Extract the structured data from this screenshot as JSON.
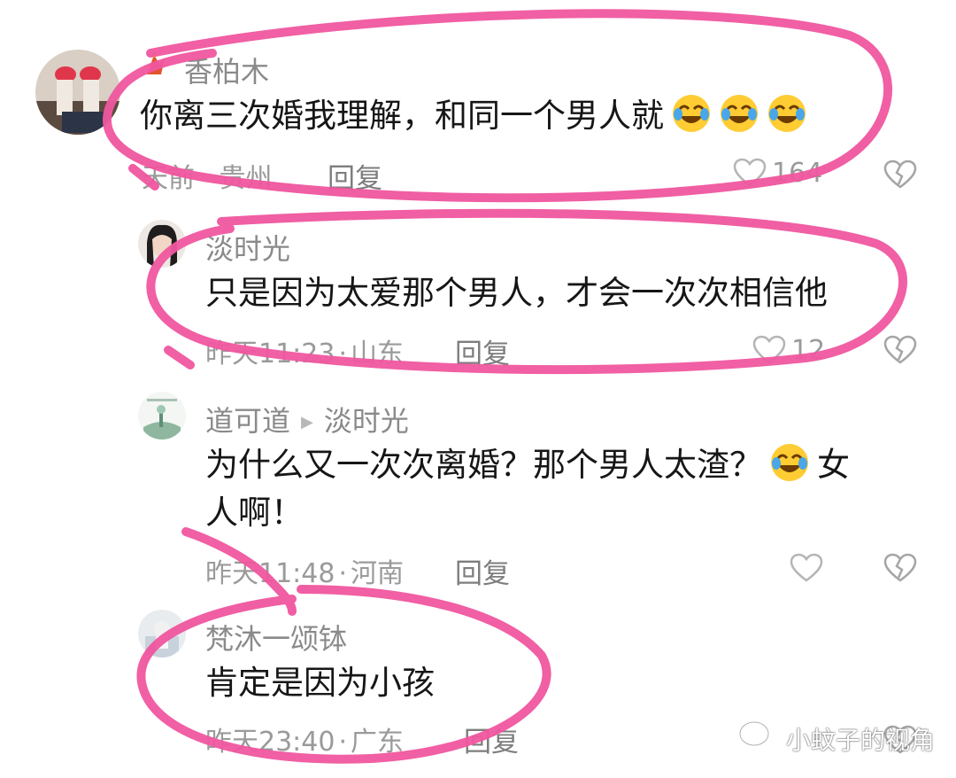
{
  "comments": [
    {
      "username": "香柏木",
      "text": "你离三次婚我理解，和同一个男人就",
      "emoji_count": 3,
      "time": "天前",
      "location": "贵州",
      "reply_label": "回复",
      "likes": "164"
    },
    {
      "username": "淡时光",
      "text": "只是因为太爱那个男人，才会一次次相信他",
      "time": "昨天11:23",
      "location": "山东",
      "reply_label": "回复",
      "likes": "12"
    },
    {
      "username": "道可道",
      "reply_to": "淡时光",
      "text_line1": "为什么又一次次离婚？那个男人太渣？",
      "text_line1_end": "女",
      "text_line2": "人啊！",
      "time": "昨天11:48",
      "location": "河南",
      "reply_label": "回复",
      "likes": ""
    },
    {
      "username": "梵沐一颂钵",
      "text": "肯定是因为小孩",
      "time": "昨天23:40",
      "location": "广东",
      "reply_label": "回复",
      "likes": ""
    }
  ],
  "watermark": "小蚊子的视角",
  "icons": {
    "like": "heart-outline-icon",
    "dislike": "broken-heart-icon",
    "emoji": "laughing-crying-emoji",
    "watermark": "wechat-icon"
  },
  "colors": {
    "highlight": "#f0569f",
    "meta": "#9a9a9a"
  }
}
